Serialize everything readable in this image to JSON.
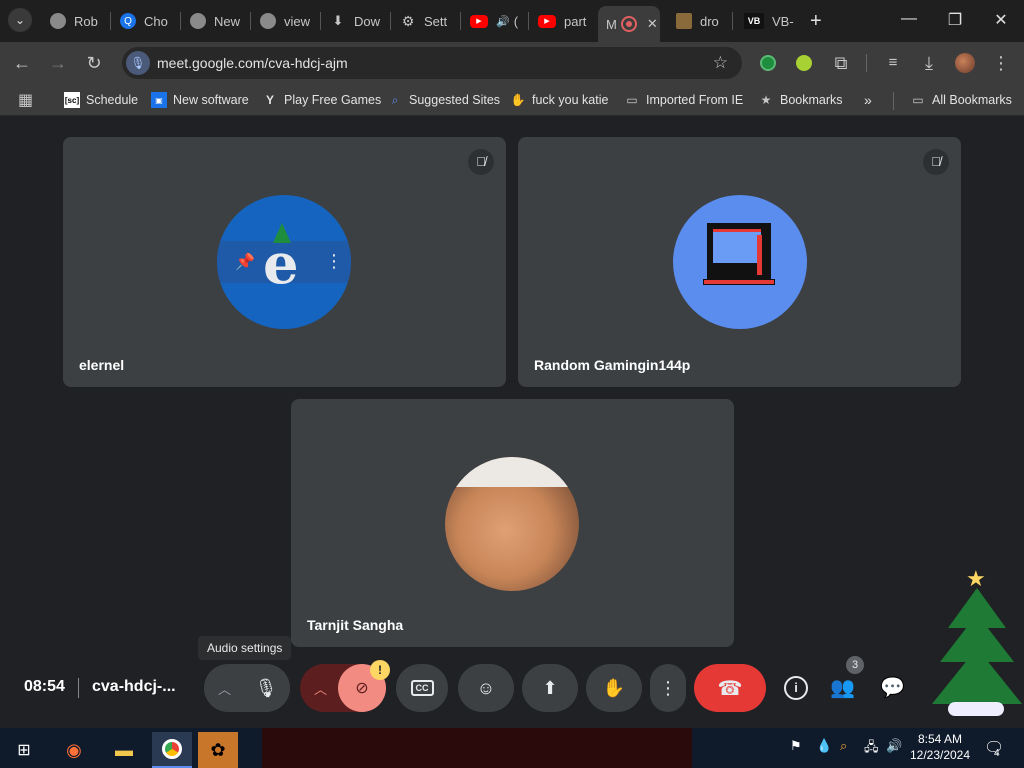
{
  "tabs": [
    {
      "label": "Rob",
      "icon": "chrome-icon",
      "color": "#8a8a8a"
    },
    {
      "label": "Cho",
      "icon": "q-icon",
      "color": "#1a73e8"
    },
    {
      "label": "New",
      "icon": "chrome-icon",
      "color": "#8a8a8a"
    },
    {
      "label": "view",
      "icon": "chrome-icon",
      "color": "#8a8a8a"
    },
    {
      "label": "Dow",
      "icon": "download-icon",
      "color": "#c7c7c7"
    },
    {
      "label": "Sett",
      "icon": "gear-icon",
      "color": "#c7c7c7"
    },
    {
      "label": "(",
      "icon": "youtube-icon",
      "color": "#ff0000"
    },
    {
      "label": "part",
      "icon": "youtube-icon",
      "color": "#ff0000"
    },
    {
      "label": "M",
      "icon": "record-icon",
      "color": "#e06060"
    },
    {
      "label": "dro",
      "icon": "folder-image-icon",
      "color": "#8a6a3a"
    },
    {
      "label": "VB-",
      "icon": "vb-icon",
      "color": "#222"
    }
  ],
  "browser": {
    "url": "meet.google.com/cva-hdcj-ajm",
    "new_tab": "+",
    "tabs_dropdown": "⌄"
  },
  "bookmarks": [
    {
      "label": "Schedule",
      "icon": "calendar-icon"
    },
    {
      "label": "New software",
      "icon": "software-icon"
    },
    {
      "label": "Play Free Games",
      "icon": "y-icon"
    },
    {
      "label": "Suggested Sites",
      "icon": "search-icon"
    },
    {
      "label": "fuck you katie",
      "icon": "hand-icon"
    },
    {
      "label": "Imported From IE",
      "icon": "folder-icon"
    },
    {
      "label": "Bookmarks",
      "icon": "star-icon"
    }
  ],
  "bookmarks_more": "»",
  "all_bookmarks": "All Bookmarks",
  "participants": [
    {
      "name": "elernel"
    },
    {
      "name": "Random Gamingin144p"
    },
    {
      "name": "Tarnjit Sangha"
    }
  ],
  "meeting": {
    "time": "08:54",
    "code": "cva-hdcj-...",
    "people_count": "3",
    "tooltip": "Audio settings",
    "badge": "!"
  },
  "colors": {
    "end_call": "#e53935",
    "cam_off": "#f28b82",
    "accent_blue": "#1a73e8",
    "tile_bg": "#3c4043"
  },
  "taskbar": {
    "time": "8:54 AM",
    "date": "12/23/2024",
    "notifications": "4"
  }
}
